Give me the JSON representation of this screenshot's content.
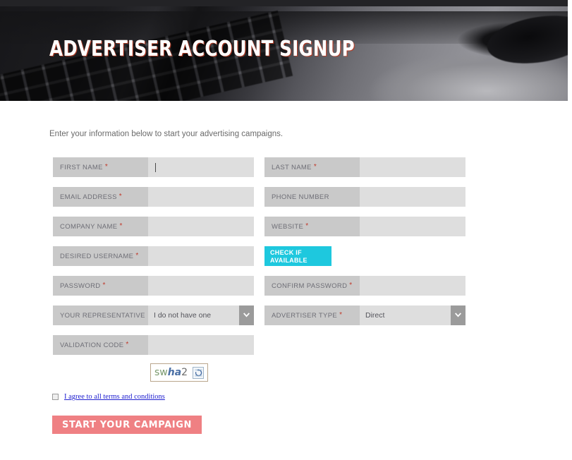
{
  "hero": {
    "title": "ADVERTISER ACCOUNT SIGNUP"
  },
  "intro": "Enter your information below to start your advertising campaigns.",
  "colors": {
    "accent_cyan": "#1ec8de",
    "submit_pink": "#ef8083",
    "label_bg": "#c9c9c9",
    "input_bg": "#dedede",
    "required_red": "#c0392b",
    "link_blue": "#2020d0"
  },
  "fields": {
    "first_name": {
      "label": "FIRST NAME",
      "required": "*",
      "value": ""
    },
    "last_name": {
      "label": "LAST NAME",
      "required": "*",
      "value": ""
    },
    "email": {
      "label": "EMAIL ADDRESS",
      "required": "*",
      "value": ""
    },
    "phone": {
      "label": "PHONE NUMBER",
      "required": "",
      "value": ""
    },
    "company": {
      "label": "COMPANY NAME",
      "required": "*",
      "value": ""
    },
    "website": {
      "label": "WEBSITE",
      "required": "*",
      "value": ""
    },
    "username": {
      "label": "DESIRED USERNAME",
      "required": "*",
      "value": ""
    },
    "password": {
      "label": "PASSWORD",
      "required": "*",
      "value": ""
    },
    "confirm": {
      "label": "CONFIRM PASSWORD",
      "required": "*",
      "value": ""
    },
    "representative": {
      "label": "YOUR REPRESENTATIVE",
      "required": "",
      "value": "I do not have one"
    },
    "advertiser_type": {
      "label": "ADVERTISER TYPE",
      "required": "*",
      "value": "Direct"
    },
    "validation_code": {
      "label": "VALIDATION CODE",
      "required": "*",
      "value": ""
    }
  },
  "check_button": {
    "line1": "CHECK IF",
    "line2": "AVAILABLE"
  },
  "captcha": {
    "part1": "sw",
    "part2": "ha",
    "part3": "2",
    "full_text": "swha2"
  },
  "terms": {
    "link_text": "I agree to all terms and conditions",
    "checked": false
  },
  "submit": {
    "label": "START YOUR CAMPAIGN"
  }
}
